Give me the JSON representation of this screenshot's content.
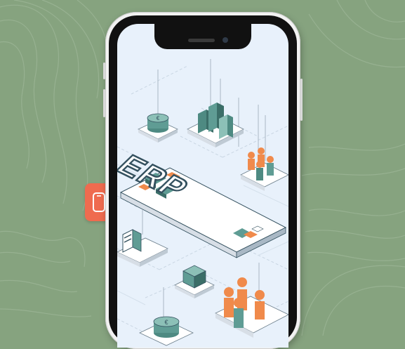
{
  "illustration": {
    "center_label": "ERP"
  },
  "icons": {
    "side_tab": "mobile-phone-icon"
  },
  "colors": {
    "background": "#86a37f",
    "accent": "#ef6b4f",
    "teal": "#5f9c94",
    "dark": "#34515f",
    "orange": "#f08a4b",
    "screen": "#e8f1fb"
  }
}
